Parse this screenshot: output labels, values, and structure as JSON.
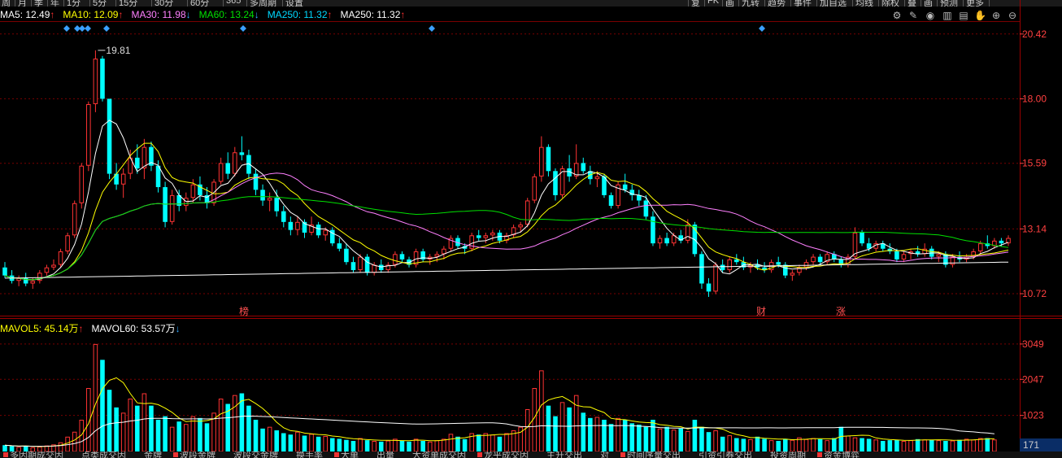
{
  "top_toolbar": [
    "周",
    "月",
    "季",
    "年",
    "1分",
    "5分",
    "15分",
    "30分",
    "60分",
    "365",
    "多周期",
    "设置",
    "复",
    "FK",
    "画",
    "九转",
    "趋势",
    "事件",
    "加自选",
    "均线",
    "除权",
    "叠",
    "画",
    "预测",
    "更多"
  ],
  "ma_legend": [
    {
      "name": "MA5",
      "value": "12.49",
      "arrow": "↑",
      "color": "#ffffff"
    },
    {
      "name": "MA10",
      "value": "12.09",
      "arrow": "↑",
      "color": "#ffff00"
    },
    {
      "name": "MA30",
      "value": "11.98",
      "arrow": "↓",
      "color": "#ff80ff"
    },
    {
      "name": "MA60",
      "value": "13.24",
      "arrow": "↓",
      "color": "#00e000"
    },
    {
      "name": "MA250",
      "value": "11.32",
      "arrow": "↑",
      "color": "#00d8ff"
    },
    {
      "name": "MA250",
      "value": "11.32",
      "arrow": "↑",
      "color": "#ffffff"
    }
  ],
  "arrow_up_color": "#ff3030",
  "arrow_down_color": "#33aaff",
  "toolbar_icons": [
    "settings-icon",
    "pen-icon",
    "eye-icon",
    "delete-icon",
    "lock-icon",
    "hand-icon",
    "zoom-in-icon",
    "zoom-out-icon"
  ],
  "price_axis": {
    "labels": [
      "20.42",
      "18.00",
      "15.59",
      "13.14",
      "10.72"
    ]
  },
  "high_annotation": "19.81",
  "markers": {
    "bang": "榜",
    "cai": "财",
    "zhang": "涨"
  },
  "volume_legend": [
    {
      "name": "MAVOL5",
      "value": "45.14万",
      "arrow": "↑",
      "color": "#ffff00"
    },
    {
      "name": "MAVOL60",
      "value": "53.57万",
      "arrow": "↓",
      "color": "#ffffff"
    }
  ],
  "volume_axis": {
    "labels": [
      "3049",
      "2047",
      "1023"
    ],
    "current": "171"
  },
  "bottom_tabs": [
    "多因期成交因",
    "点类成交因",
    "金牌",
    "波段金牌",
    "波段交金牌",
    "换手率",
    "大单",
    "出量",
    "大资单成交因",
    "龙乎成交因",
    "主升交出",
    "对",
    "时间序量交出",
    "引资引券交出",
    "投资周期",
    "资金博弈"
  ],
  "colors": {
    "up": "#ff3333",
    "down": "#00ffff",
    "ma5": "#ffffff",
    "ma10": "#ffff00",
    "ma30": "#ff80ff",
    "ma60": "#00e000",
    "ma250": "#ffffff",
    "grid": "#7a0000",
    "axis": "#990000"
  },
  "chart_data": {
    "type": "candlestick",
    "ylim": [
      9.9,
      20.9
    ],
    "volume_ylim": [
      0,
      3300
    ],
    "candles": [
      [
        11.7,
        11.9,
        11.3,
        11.4
      ],
      [
        11.4,
        11.6,
        11.1,
        11.2
      ],
      [
        11.2,
        11.4,
        11.0,
        11.3
      ],
      [
        11.3,
        11.5,
        11.0,
        11.1
      ],
      [
        11.1,
        11.3,
        10.9,
        11.2
      ],
      [
        11.2,
        11.6,
        11.1,
        11.5
      ],
      [
        11.5,
        11.8,
        11.4,
        11.7
      ],
      [
        11.7,
        12.0,
        11.6,
        11.8
      ],
      [
        11.8,
        12.4,
        11.7,
        12.3
      ],
      [
        12.3,
        13.0,
        12.2,
        12.9
      ],
      [
        12.9,
        14.2,
        12.8,
        14.1
      ],
      [
        14.1,
        15.6,
        13.9,
        15.5
      ],
      [
        15.5,
        17.9,
        15.3,
        17.8
      ],
      [
        17.8,
        19.81,
        17.5,
        19.5
      ],
      [
        19.5,
        19.6,
        17.9,
        18.0
      ],
      [
        18.0,
        16.8,
        15.0,
        15.2
      ],
      [
        15.2,
        15.6,
        14.6,
        14.8
      ],
      [
        14.8,
        15.4,
        14.3,
        15.2
      ],
      [
        15.2,
        16.1,
        15.0,
        15.8
      ],
      [
        15.8,
        16.3,
        15.2,
        15.4
      ],
      [
        15.4,
        16.5,
        15.0,
        16.2
      ],
      [
        16.2,
        16.4,
        15.3,
        15.5
      ],
      [
        15.5,
        15.7,
        14.5,
        14.7
      ],
      [
        14.7,
        14.9,
        13.2,
        13.4
      ],
      [
        13.4,
        14.6,
        13.3,
        14.4
      ],
      [
        14.4,
        14.6,
        13.8,
        14.0
      ],
      [
        14.0,
        14.5,
        13.8,
        14.3
      ],
      [
        14.3,
        15.0,
        14.1,
        14.8
      ],
      [
        14.8,
        15.1,
        14.2,
        14.4
      ],
      [
        14.4,
        14.7,
        13.9,
        14.1
      ],
      [
        14.1,
        15.0,
        14.0,
        14.9
      ],
      [
        14.9,
        15.8,
        14.8,
        15.6
      ],
      [
        15.6,
        16.0,
        15.0,
        15.2
      ],
      [
        15.2,
        16.2,
        15.1,
        16.0
      ],
      [
        16.0,
        16.6,
        15.7,
        15.9
      ],
      [
        15.9,
        16.1,
        15.0,
        15.2
      ],
      [
        15.2,
        15.4,
        14.4,
        14.6
      ],
      [
        14.6,
        14.8,
        14.0,
        14.2
      ],
      [
        14.2,
        14.5,
        13.8,
        14.3
      ],
      [
        14.3,
        14.6,
        13.6,
        13.8
      ],
      [
        13.8,
        14.0,
        13.2,
        13.4
      ],
      [
        13.4,
        13.6,
        12.9,
        13.1
      ],
      [
        13.1,
        13.6,
        12.9,
        13.4
      ],
      [
        13.4,
        13.5,
        12.8,
        13.0
      ],
      [
        13.0,
        13.6,
        12.9,
        13.3
      ],
      [
        13.3,
        13.4,
        12.8,
        12.9
      ],
      [
        12.9,
        13.2,
        12.7,
        13.1
      ],
      [
        13.1,
        13.2,
        12.5,
        12.6
      ],
      [
        12.6,
        12.8,
        12.3,
        12.4
      ],
      [
        12.4,
        12.6,
        11.8,
        11.9
      ],
      [
        11.9,
        12.1,
        11.5,
        11.6
      ],
      [
        11.6,
        12.2,
        11.5,
        12.1
      ],
      [
        12.1,
        12.2,
        11.4,
        11.5
      ],
      [
        11.5,
        11.9,
        11.4,
        11.8
      ],
      [
        11.8,
        12.0,
        11.5,
        11.6
      ],
      [
        11.6,
        11.9,
        11.5,
        11.8
      ],
      [
        11.8,
        12.3,
        11.7,
        12.2
      ],
      [
        12.2,
        12.3,
        11.9,
        12.0
      ],
      [
        12.0,
        12.1,
        11.7,
        11.8
      ],
      [
        11.8,
        12.4,
        11.7,
        12.3
      ],
      [
        12.3,
        12.4,
        11.9,
        12.0
      ],
      [
        12.0,
        12.2,
        11.8,
        12.1
      ],
      [
        12.1,
        12.3,
        11.9,
        12.2
      ],
      [
        12.2,
        12.5,
        12.0,
        12.4
      ],
      [
        12.4,
        12.9,
        12.3,
        12.8
      ],
      [
        12.8,
        12.9,
        12.4,
        12.5
      ],
      [
        12.5,
        12.6,
        12.2,
        12.4
      ],
      [
        12.4,
        13.0,
        12.3,
        12.9
      ],
      [
        12.9,
        13.1,
        12.7,
        12.8
      ],
      [
        12.8,
        13.0,
        12.6,
        12.9
      ],
      [
        12.9,
        13.1,
        12.7,
        13.0
      ],
      [
        13.0,
        13.1,
        12.6,
        12.7
      ],
      [
        12.7,
        13.0,
        12.6,
        12.9
      ],
      [
        12.9,
        13.3,
        12.8,
        13.2
      ],
      [
        13.2,
        13.4,
        13.0,
        13.3
      ],
      [
        13.3,
        14.3,
        13.2,
        14.2
      ],
      [
        14.2,
        15.2,
        14.1,
        15.1
      ],
      [
        15.1,
        16.6,
        14.9,
        16.2
      ],
      [
        16.2,
        16.3,
        15.1,
        15.3
      ],
      [
        15.3,
        15.4,
        14.2,
        14.4
      ],
      [
        14.4,
        15.5,
        14.3,
        15.4
      ],
      [
        15.4,
        15.9,
        14.9,
        15.1
      ],
      [
        15.1,
        16.3,
        15.0,
        15.6
      ],
      [
        15.6,
        15.8,
        15.2,
        15.3
      ],
      [
        15.3,
        15.5,
        14.8,
        15.0
      ],
      [
        15.0,
        15.3,
        14.7,
        15.1
      ],
      [
        15.1,
        15.2,
        14.3,
        14.4
      ],
      [
        14.4,
        14.5,
        13.9,
        14.0
      ],
      [
        14.0,
        14.9,
        13.9,
        14.8
      ],
      [
        14.8,
        15.2,
        14.5,
        14.6
      ],
      [
        14.6,
        14.8,
        14.2,
        14.4
      ],
      [
        14.4,
        14.6,
        14.0,
        14.2
      ],
      [
        14.2,
        14.4,
        13.5,
        13.6
      ],
      [
        13.6,
        13.8,
        12.5,
        12.6
      ],
      [
        12.6,
        12.9,
        12.4,
        12.8
      ],
      [
        12.8,
        13.0,
        12.5,
        12.6
      ],
      [
        12.6,
        13.0,
        12.5,
        12.9
      ],
      [
        12.9,
        13.1,
        12.6,
        12.7
      ],
      [
        12.7,
        13.5,
        12.6,
        13.3
      ],
      [
        13.3,
        13.4,
        12.1,
        12.2
      ],
      [
        12.2,
        12.3,
        10.9,
        11.1
      ],
      [
        11.1,
        11.3,
        10.6,
        10.8
      ],
      [
        10.8,
        11.9,
        10.7,
        11.8
      ],
      [
        11.8,
        12.0,
        11.5,
        11.6
      ],
      [
        11.6,
        12.1,
        11.5,
        12.0
      ],
      [
        12.0,
        12.2,
        11.8,
        11.9
      ],
      [
        11.9,
        12.1,
        11.6,
        11.7
      ],
      [
        11.7,
        11.9,
        11.5,
        11.8
      ],
      [
        11.8,
        12.0,
        11.6,
        11.7
      ],
      [
        11.7,
        11.9,
        11.5,
        11.6
      ],
      [
        11.6,
        12.0,
        11.5,
        11.9
      ],
      [
        11.9,
        12.1,
        11.7,
        11.8
      ],
      [
        11.8,
        11.9,
        11.3,
        11.4
      ],
      [
        11.4,
        11.6,
        11.2,
        11.5
      ],
      [
        11.5,
        11.8,
        11.4,
        11.7
      ],
      [
        11.7,
        12.0,
        11.6,
        11.9
      ],
      [
        11.9,
        12.2,
        11.8,
        12.1
      ],
      [
        12.1,
        12.2,
        11.8,
        11.9
      ],
      [
        11.9,
        12.3,
        11.8,
        12.2
      ],
      [
        12.2,
        12.3,
        11.9,
        12.0
      ],
      [
        12.0,
        12.1,
        11.7,
        11.8
      ],
      [
        11.8,
        12.2,
        11.7,
        12.1
      ],
      [
        12.1,
        13.2,
        12.0,
        13.0
      ],
      [
        13.0,
        13.1,
        12.5,
        12.6
      ],
      [
        12.6,
        12.8,
        12.3,
        12.4
      ],
      [
        12.4,
        12.7,
        12.3,
        12.6
      ],
      [
        12.6,
        12.7,
        12.3,
        12.4
      ],
      [
        12.4,
        12.6,
        12.2,
        12.3
      ],
      [
        12.3,
        12.4,
        11.9,
        12.0
      ],
      [
        12.0,
        12.3,
        11.9,
        12.2
      ],
      [
        12.2,
        12.4,
        12.0,
        12.3
      ],
      [
        12.3,
        12.5,
        12.1,
        12.2
      ],
      [
        12.2,
        12.6,
        12.1,
        12.4
      ],
      [
        12.4,
        12.5,
        12.0,
        12.1
      ],
      [
        12.1,
        12.3,
        11.9,
        12.2
      ],
      [
        12.2,
        12.3,
        11.7,
        11.8
      ],
      [
        11.8,
        12.2,
        11.7,
        12.1
      ],
      [
        12.1,
        12.3,
        11.9,
        12.0
      ],
      [
        12.0,
        12.2,
        11.9,
        12.1
      ],
      [
        12.1,
        12.4,
        12.0,
        12.3
      ],
      [
        12.3,
        12.7,
        12.2,
        12.6
      ],
      [
        12.6,
        12.9,
        12.4,
        12.5
      ],
      [
        12.5,
        12.8,
        12.4,
        12.7
      ],
      [
        12.7,
        12.8,
        12.5,
        12.6
      ],
      [
        12.6,
        12.9,
        12.5,
        12.8
      ]
    ],
    "volume": [
      180,
      150,
      130,
      160,
      120,
      140,
      170,
      200,
      260,
      420,
      560,
      900,
      1800,
      3049,
      2600,
      1750,
      1250,
      1100,
      1500,
      1300,
      1650,
      1300,
      900,
      1000,
      700,
      850,
      780,
      1000,
      950,
      800,
      1100,
      1500,
      1350,
      1600,
      1650,
      1300,
      900,
      650,
      700,
      600,
      520,
      480,
      560,
      450,
      500,
      420,
      440,
      380,
      360,
      330,
      300,
      380,
      320,
      300,
      280,
      310,
      360,
      300,
      280,
      360,
      300,
      280,
      320,
      360,
      500,
      420,
      350,
      520,
      480,
      520,
      480,
      420,
      520,
      600,
      700,
      1200,
      1800,
      2300,
      1300,
      1000,
      1400,
      1250,
      1600,
      1100,
      950,
      980,
      900,
      780,
      950,
      900,
      800,
      760,
      700,
      900,
      650,
      700,
      620,
      650,
      580,
      900,
      700,
      550,
      600,
      420,
      460,
      380,
      360,
      350,
      420,
      360,
      320,
      300,
      360,
      330,
      400,
      350,
      380,
      350,
      320,
      380,
      700,
      450,
      400,
      380,
      360,
      340,
      300,
      320,
      330,
      300,
      320,
      350,
      340,
      330,
      320,
      300,
      310,
      330,
      360,
      340,
      380,
      380,
      340
    ],
    "series": [
      {
        "name": "MA5"
      },
      {
        "name": "MA10"
      },
      {
        "name": "MA30"
      },
      {
        "name": "MA60"
      },
      {
        "name": "MA250"
      }
    ],
    "vol_series": [
      {
        "name": "MAVOL5"
      },
      {
        "name": "MAVOL60"
      }
    ]
  }
}
